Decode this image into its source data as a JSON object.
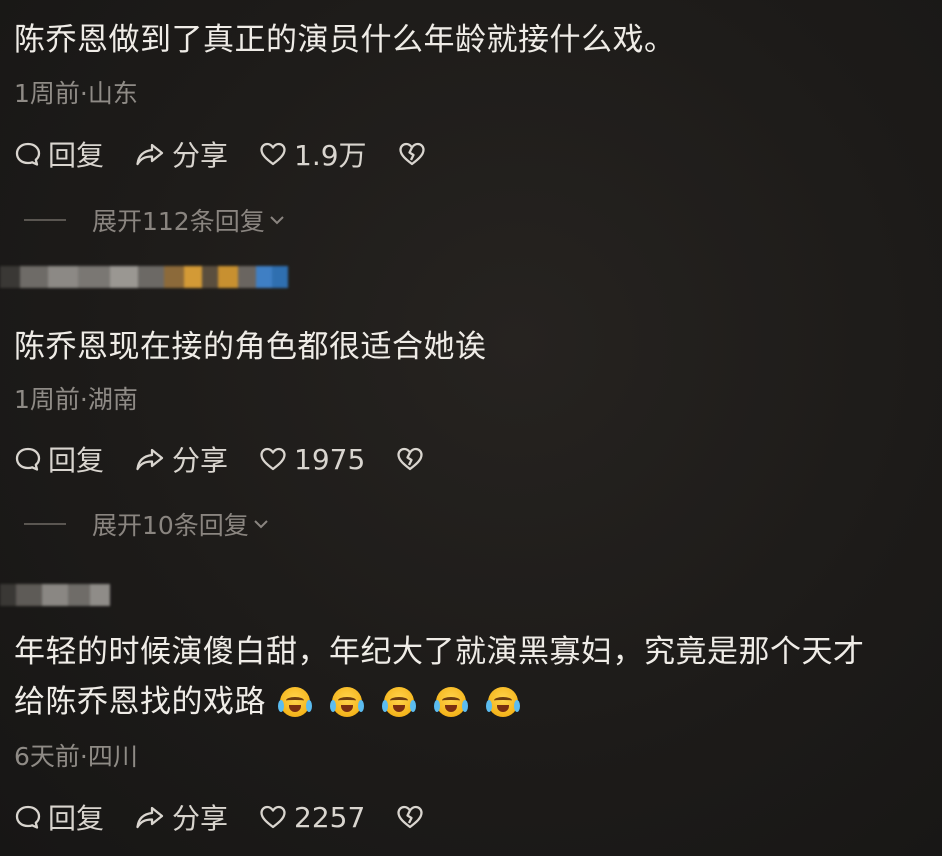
{
  "comments": [
    {
      "text": "陈乔恩做到了真正的演员什么年龄就接什么戏。",
      "meta": "1周前·山东",
      "reply": "回复",
      "share": "分享",
      "likes": "1.9万",
      "expand": "展开112条回复"
    },
    {
      "text": "陈乔恩现在接的角色都很适合她诶",
      "meta": "1周前·湖南",
      "reply": "回复",
      "share": "分享",
      "likes": "1975",
      "expand": "展开10条回复"
    },
    {
      "text_line1": "年轻的时候演傻白甜，年纪大了就演黑寡妇，究竟是那个天才",
      "text_line2": "给陈乔恩找的戏路",
      "meta": "6天前·四川",
      "reply": "回复",
      "share": "分享",
      "likes": "2257"
    }
  ],
  "icons": {
    "reply": "speech-bubble-icon",
    "share": "share-arrow-icon",
    "like": "heart-icon",
    "dislike": "broken-heart-icon",
    "expand": "chevron-down-icon",
    "emoji": "crying-laughing-emoji"
  }
}
